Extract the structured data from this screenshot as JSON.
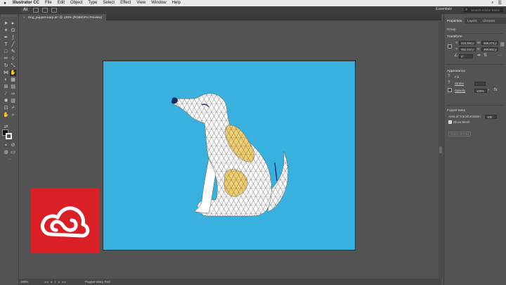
{
  "menubar": {
    "app_name": "Illustrator CC",
    "items": [
      "File",
      "Edit",
      "Object",
      "Type",
      "Select",
      "Effect",
      "View",
      "Window",
      "Help"
    ]
  },
  "appbar": {
    "workspace": "Essentials",
    "search_placeholder": "Search Adobe Stock"
  },
  "document_tab": {
    "close_glyph": "×",
    "title": "Dog_puppet-warp.ai* @ 100% (RGB/GPU Preview)"
  },
  "panel": {
    "tabs": [
      "Properties",
      "Layers",
      "Libraries"
    ],
    "selection_type": "Group",
    "transform": {
      "section_title": "Transform",
      "x_label": "X:",
      "x_value": "216.093 p",
      "y_label": "Y:",
      "y_value": "362.404 p",
      "w_label": "W:",
      "w_value": "489.273 p",
      "h_label": "H:",
      "h_value": "468.902 p",
      "angle_value": "0°"
    },
    "appearance": {
      "section_title": "Appearance",
      "fill_label": "Fill",
      "stroke_label": "Stroke",
      "opacity_label": "Opacity",
      "opacity_value": "100%"
    },
    "puppet_warp": {
      "section_title": "Puppet Warp",
      "area_label": "Area of Transformation",
      "area_value": "100",
      "show_mesh_label": "Show Mesh",
      "select_all_pins_label": "Select All Pins"
    }
  },
  "status": {
    "zoom": "100%",
    "nav": "◂◂ ◂ 1 ▸ ▸▸",
    "tool_name": "Puppet Warp Tool"
  },
  "colors": {
    "artboard": "#38b1de",
    "dog_body": "#ffffff",
    "dog_patch": "#f2cd6b",
    "mesh_lines": "#6b6b6b",
    "dog_details": "#1b2a66",
    "cc_logo": "#da1f26"
  }
}
